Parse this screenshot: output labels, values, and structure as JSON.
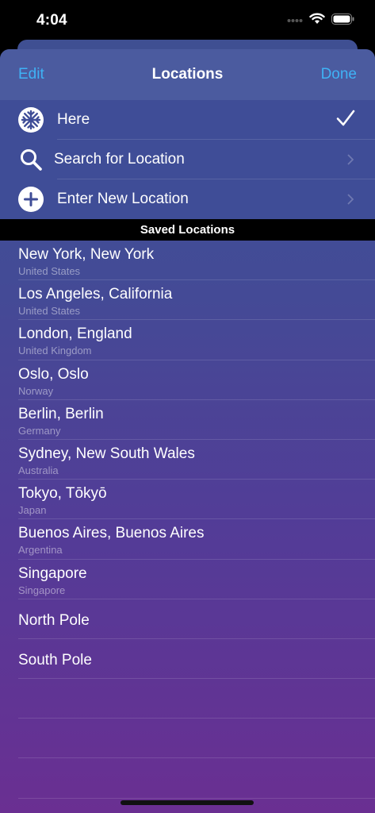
{
  "status": {
    "time": "4:04"
  },
  "nav": {
    "left": "Edit",
    "title": "Locations",
    "right": "Done"
  },
  "menu": [
    {
      "label": "Here",
      "icon": "snowflake-icon",
      "accessory": "checkmark"
    },
    {
      "label": "Search for Location",
      "icon": "search-icon",
      "accessory": "chevron"
    },
    {
      "label": "Enter New Location",
      "icon": "plus-circle-icon",
      "accessory": "chevron"
    }
  ],
  "section_header": "Saved Locations",
  "locations": [
    {
      "name": "New York, New York",
      "country": "United States"
    },
    {
      "name": "Los Angeles, California",
      "country": "United States"
    },
    {
      "name": "London, England",
      "country": "United Kingdom"
    },
    {
      "name": "Oslo, Oslo",
      "country": "Norway"
    },
    {
      "name": "Berlin, Berlin",
      "country": "Germany"
    },
    {
      "name": "Sydney, New South Wales",
      "country": "Australia"
    },
    {
      "name": "Tokyo, Tōkyō",
      "country": "Japan"
    },
    {
      "name": "Buenos Aires, Buenos Aires",
      "country": "Argentina"
    },
    {
      "name": "Singapore",
      "country": "Singapore"
    },
    {
      "name": "North Pole",
      "country": ""
    },
    {
      "name": "South Pole",
      "country": ""
    }
  ],
  "colors": {
    "accent": "#3fb2f5",
    "sheet_top": "#3f4f94",
    "sheet_bottom": "#6a2f92"
  }
}
